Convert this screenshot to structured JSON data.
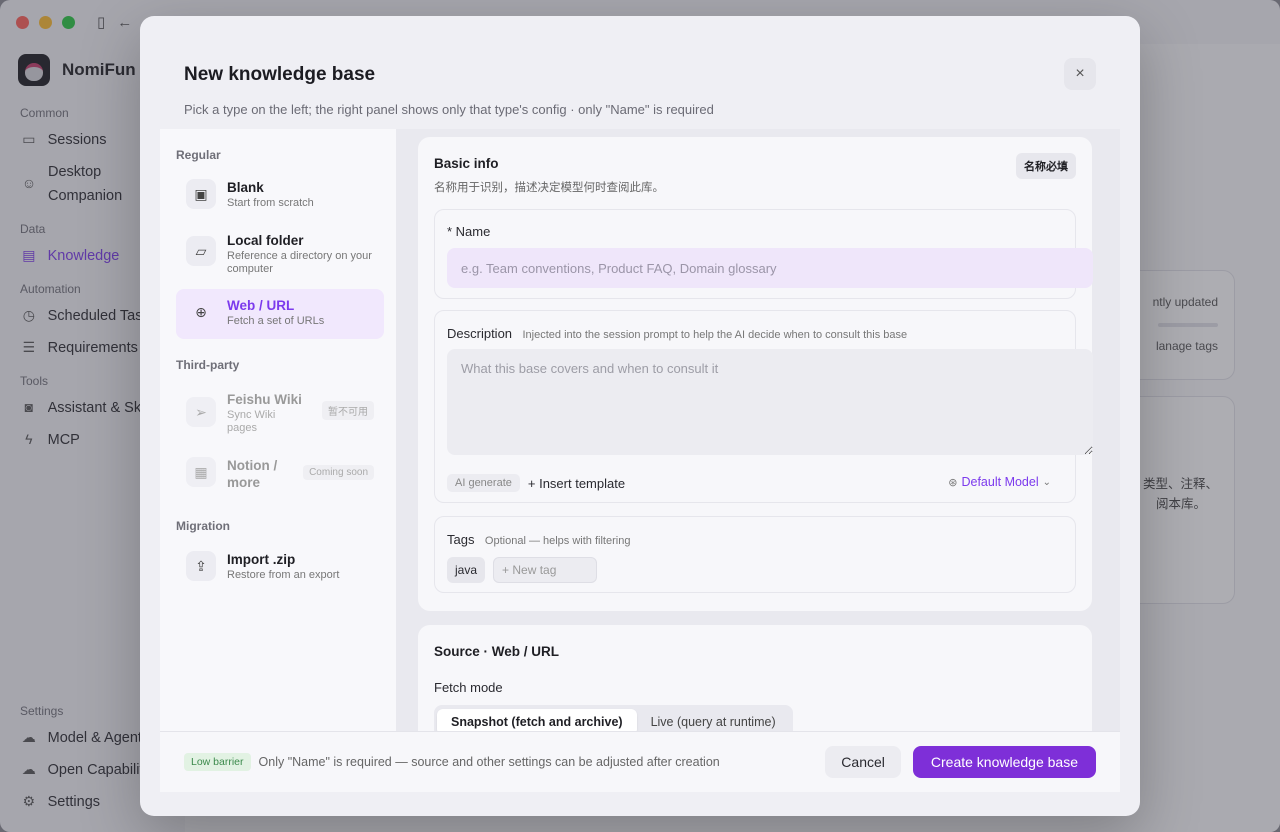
{
  "app": {
    "name": "NomiFun",
    "sections": [
      {
        "label": "Common",
        "items": [
          {
            "label": "Sessions",
            "icon": "sessions-icon"
          },
          {
            "label": "Desktop Companion",
            "icon": "companion-icon"
          }
        ]
      },
      {
        "label": "Data",
        "items": [
          {
            "label": "Knowledge",
            "icon": "knowledge-icon"
          }
        ]
      },
      {
        "label": "Automation",
        "items": [
          {
            "label": "Scheduled Tasks",
            "icon": "clock-icon"
          },
          {
            "label": "Requirements",
            "icon": "list-icon"
          }
        ]
      },
      {
        "label": "Tools",
        "items": [
          {
            "label": "Assistant & Skills",
            "icon": "robot-icon"
          },
          {
            "label": "MCP",
            "icon": "bolt-icon"
          }
        ]
      },
      {
        "label": "Settings",
        "items": [
          {
            "label": "Model & Agent",
            "icon": "cloud-icon"
          },
          {
            "label": "Open Capabilities",
            "icon": "cloud-icon"
          },
          {
            "label": "Settings",
            "icon": "gear-icon"
          }
        ]
      }
    ],
    "bg_text": {
      "sort": "ntly updated",
      "manage_tags": "lanage tags",
      "desc_line1": "类型、注释、",
      "desc_line2": "阅本库。"
    }
  },
  "modal": {
    "title": "New knowledge base",
    "subtitle": "Pick a type on the left; the right panel shows only that type's config · only \"Name\" is required",
    "close_icon": "×"
  },
  "types": {
    "regular_label": "Regular",
    "thirdparty_label": "Third-party",
    "migration_label": "Migration",
    "blank": {
      "title": "Blank",
      "desc": "Start from scratch"
    },
    "local": {
      "title": "Local folder",
      "desc": "Reference a directory on your computer"
    },
    "web": {
      "title": "Web / URL",
      "desc": "Fetch a set of URLs"
    },
    "feishu": {
      "title": "Feishu Wiki",
      "desc": "Sync Wiki pages",
      "badge": "暂不可用"
    },
    "notion": {
      "title": "Notion / more",
      "badge": "Coming soon"
    },
    "import": {
      "title": "Import .zip",
      "desc": "Restore from an export"
    }
  },
  "basic": {
    "title": "Basic info",
    "badge": "名称必填",
    "subtitle": "名称用于识别，描述决定模型何时查阅此库。",
    "name_label": "* Name",
    "name_placeholder": "e.g. Team conventions, Product FAQ, Domain glossary",
    "desc_label": "Description",
    "desc_hint": "Injected into the session prompt to help the AI decide when to consult this base",
    "desc_placeholder": "What this base covers and when to consult it",
    "ai_generate": "AI generate",
    "insert_template": "+ Insert template",
    "model": "Default Model",
    "tags_label": "Tags",
    "tags_hint": "Optional — helps with filtering",
    "tags": [
      "java"
    ],
    "tag_placeholder": "+ New tag"
  },
  "source": {
    "title": "Source · Web / URL",
    "fetch_label": "Fetch mode",
    "modes": [
      "Snapshot (fetch and archive)",
      "Live (query at runtime)"
    ]
  },
  "footer": {
    "badge": "Low barrier",
    "note": "Only \"Name\" is required — source and other settings can be adjusted after creation",
    "cancel": "Cancel",
    "create": "Create knowledge base"
  },
  "colors": {
    "accent": "#7e2fd8",
    "selected_bg": "#f1e8fd",
    "name_field_bg": "#efe6fa"
  }
}
